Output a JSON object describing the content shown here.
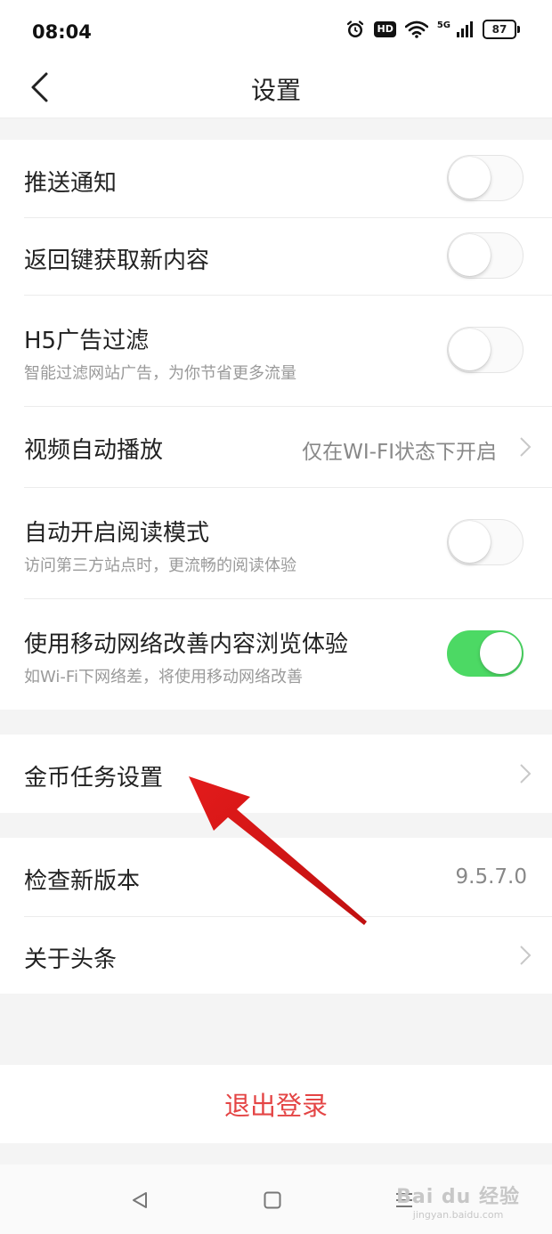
{
  "status_bar": {
    "time": "08:04",
    "network_label": "5G",
    "hd_label": "HD",
    "battery_level": "87",
    "icons": [
      "alarm-icon",
      "hd-icon",
      "wifi-icon",
      "signal-icon",
      "battery-icon"
    ]
  },
  "header": {
    "back_icon": "chevron-left-icon",
    "title": "设置"
  },
  "settings": {
    "push": {
      "title": "推送通知",
      "enabled": false
    },
    "back_key": {
      "title": "返回键获取新内容",
      "enabled": false
    },
    "h5_filter": {
      "title": "H5广告过滤",
      "subtitle": "智能过滤网站广告，为你节省更多流量",
      "enabled": false
    },
    "video_autoplay": {
      "title": "视频自动播放",
      "value": "仅在WI-FI状态下开启"
    },
    "reading_mode": {
      "title": "自动开启阅读模式",
      "subtitle": "访问第三方站点时，更流畅的阅读体验",
      "enabled": false
    },
    "mobile_network": {
      "title": "使用移动网络改善内容浏览体验",
      "subtitle": "如Wi-Fi下网络差，将使用移动网络改善",
      "enabled": true
    },
    "coin_tasks": {
      "title": "金币任务设置"
    },
    "check_version": {
      "title": "检查新版本",
      "value": "9.5.7.0"
    },
    "about": {
      "title": "关于头条"
    }
  },
  "logout": {
    "label": "退出登录"
  },
  "system_nav": {
    "back_icon": "triangle-back-icon",
    "home_icon": "square-home-icon",
    "menu_icon": "menu-lines-icon"
  },
  "watermark": {
    "brand": "Bai du 经验",
    "url": "jingyan.baidu.com"
  },
  "colors": {
    "toggle_on": "#4cd964",
    "logout_text": "#e44545",
    "annotation_arrow": "#e31b1b",
    "background": "#f4f4f4"
  }
}
